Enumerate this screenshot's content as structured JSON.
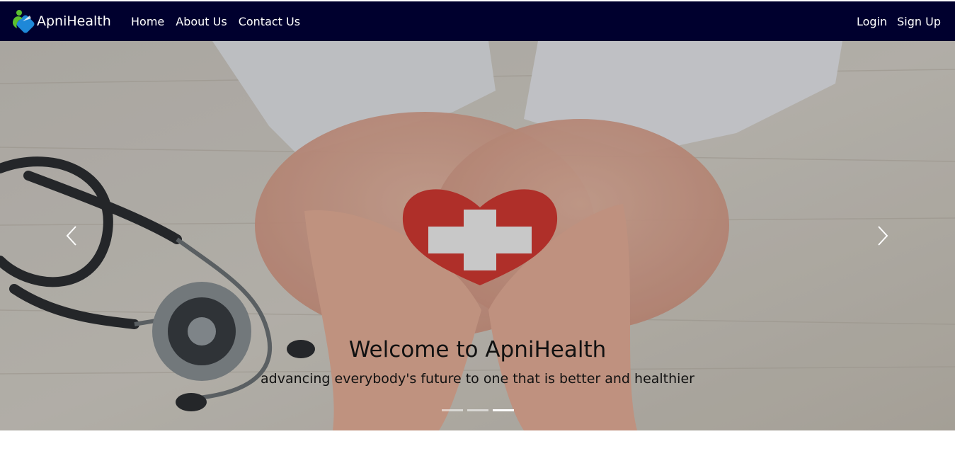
{
  "brand": {
    "name": "ApniHealth",
    "icon": "apnihealth-logo-icon"
  },
  "nav": {
    "left": [
      {
        "label": "Home"
      },
      {
        "label": "About Us"
      },
      {
        "label": "Contact Us"
      }
    ],
    "right": [
      {
        "label": "Login"
      },
      {
        "label": "Sign Up"
      }
    ]
  },
  "hero": {
    "title": "Welcome to ApniHealth",
    "subtitle": "advancing everybody's future to one that is better and healthier",
    "prev_icon": "chevron-left-icon",
    "next_icon": "chevron-right-icon",
    "slides_count": 3,
    "active_slide": 3
  },
  "colors": {
    "navbar_bg": "#00002e",
    "nav_text": "#ffffff",
    "heart": "#d63a32",
    "logo_green": "#5bbf2e",
    "logo_blue": "#1e88d8"
  }
}
